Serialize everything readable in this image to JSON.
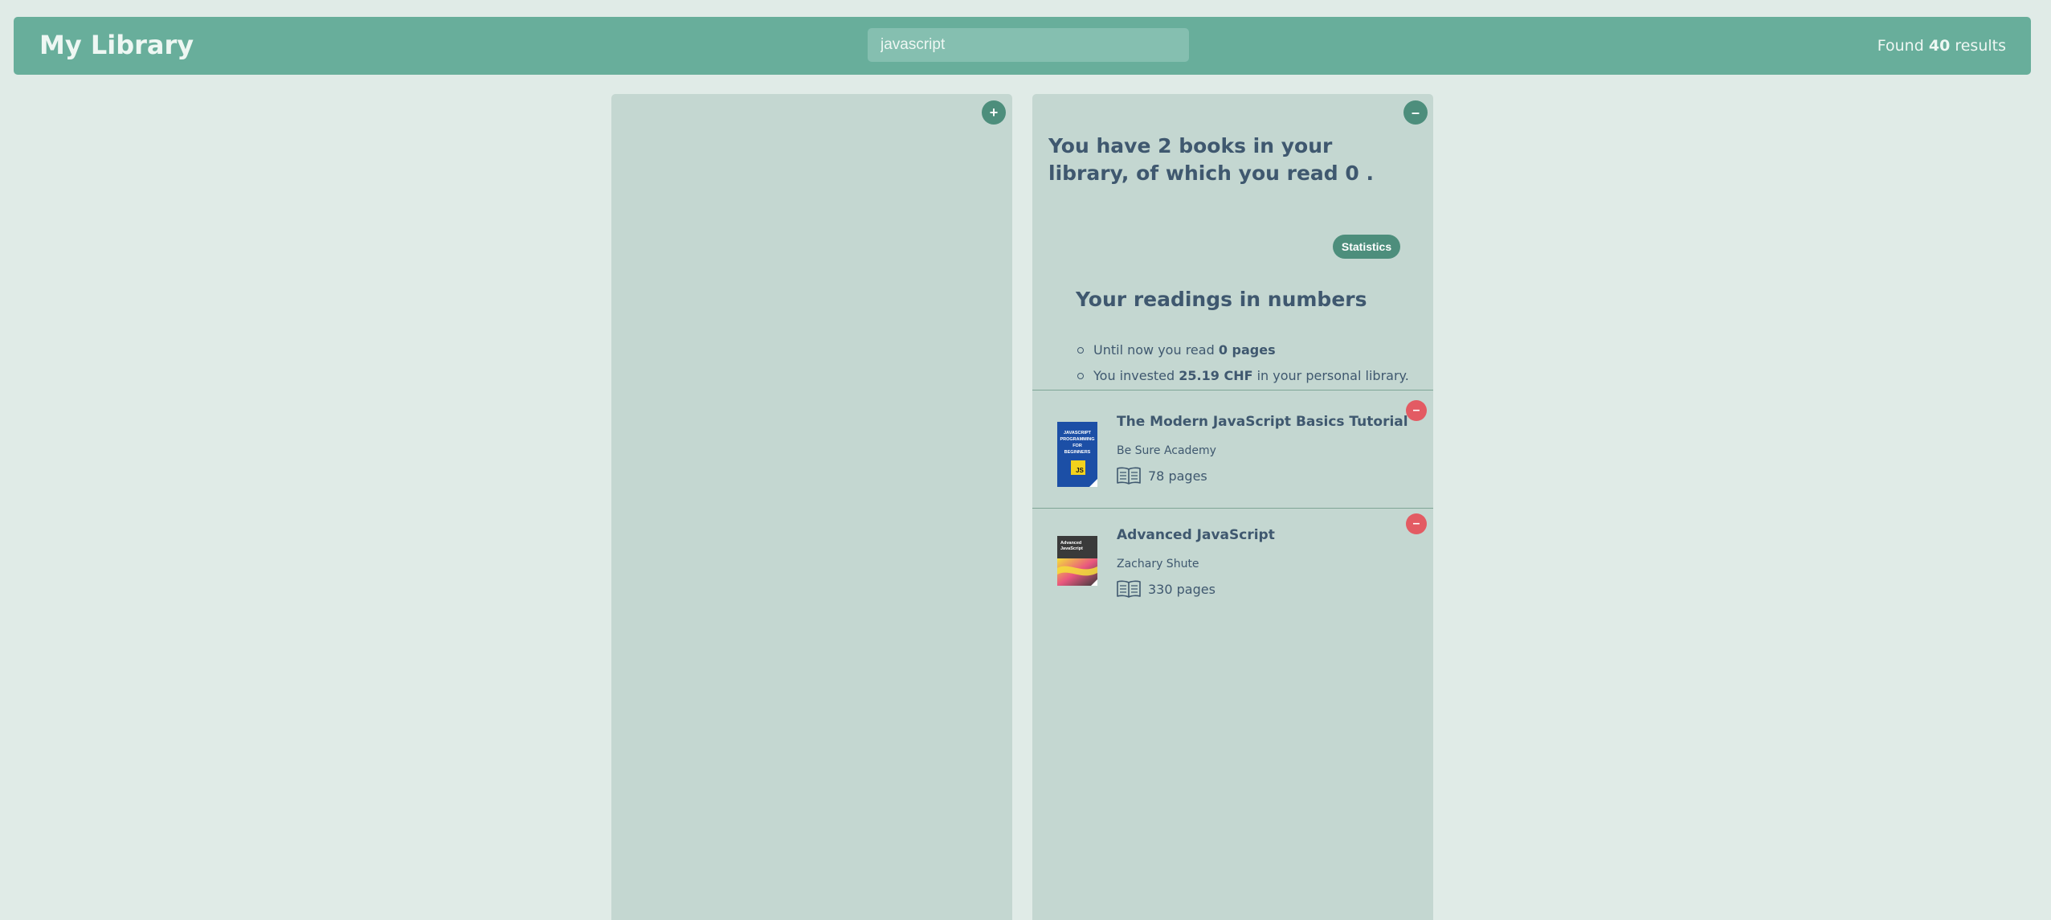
{
  "header": {
    "title": "My Library",
    "search_value": "javascript",
    "results_prefix": "Found",
    "results_count": "40",
    "results_suffix": "results"
  },
  "left_panel": {
    "toggle_label": "+"
  },
  "right_panel": {
    "toggle_label": "–",
    "summary": "You have 2 books in your library, of which you read 0 .",
    "stats_button": "Statistics",
    "stats_title": "Your readings in numbers",
    "stats": {
      "pages_prefix": "Until now you read ",
      "pages_value": "0 pages",
      "invest_prefix": "You invested ",
      "invest_value": "25.19 CHF",
      "invest_suffix": " in your personal library."
    },
    "books": [
      {
        "title": "The Modern JavaScript Basics Tutorial",
        "author": "Be Sure Academy",
        "pages": "78 pages",
        "remove_label": "–",
        "cover_lines": [
          "JAVASCRIPT",
          "PROGRAMMING",
          "FOR",
          "BEGINNERS"
        ],
        "cover_badge": "JS"
      },
      {
        "title": "Advanced JavaScript",
        "author": "Zachary Shute",
        "pages": "330 pages",
        "remove_label": "–",
        "cover_lines": [
          "Advanced",
          "JavaScript"
        ]
      }
    ]
  },
  "colors": {
    "background": "#e0ebe7",
    "header": "#68ae9b",
    "panel": "#c4d7d1",
    "accent": "#4d8e7c",
    "remove": "#e35b63",
    "text": "#3f586f"
  }
}
